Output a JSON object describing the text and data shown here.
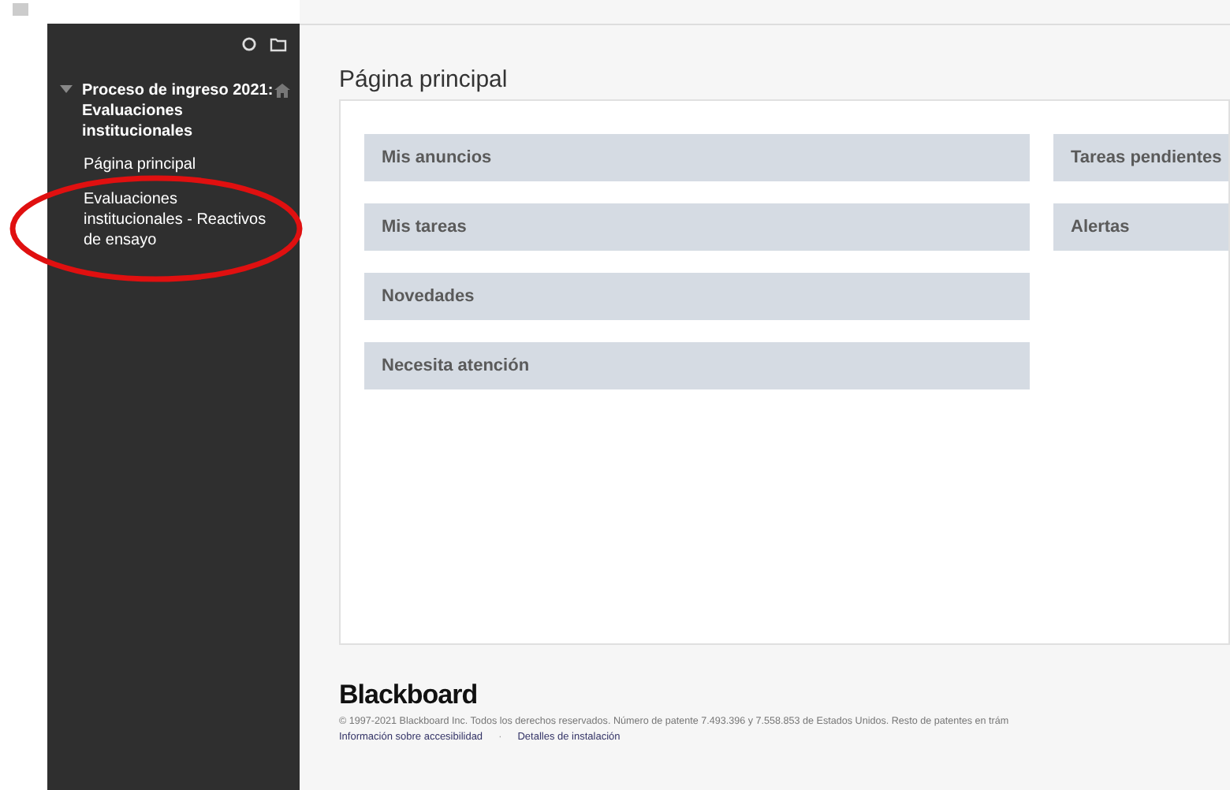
{
  "sidebar": {
    "course": {
      "title": "Proceso de ingreso 2021: Evaluaciones institucionales",
      "expanded": true
    },
    "items": [
      {
        "label": "Página principal"
      },
      {
        "label": "Evaluaciones institucionales - Reactivos de ensayo",
        "highlighted": true
      }
    ]
  },
  "page": {
    "title": "Página principal",
    "modules_left": [
      {
        "label": "Mis anuncios"
      },
      {
        "label": "Mis tareas"
      },
      {
        "label": "Novedades"
      },
      {
        "label": "Necesita atención"
      }
    ],
    "modules_right": [
      {
        "label": "Tareas pendientes"
      },
      {
        "label": "Alertas"
      }
    ]
  },
  "footer": {
    "logo": "Blackboard",
    "copyright": "© 1997-2021 Blackboard Inc. Todos los derechos reservados. Número de patente 7.493.396 y 7.558.853 de Estados Unidos. Resto de patentes en trám",
    "links": [
      "Información sobre accesibilidad",
      "Detalles de instalación"
    ],
    "separator": "·"
  }
}
